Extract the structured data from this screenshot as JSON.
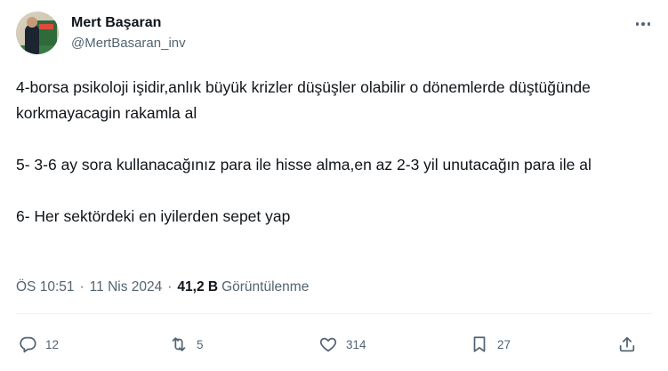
{
  "author": {
    "name": "Mert Başaran",
    "handle": "@MertBasaran_inv"
  },
  "tweet": {
    "paragraphs": [
      "4-borsa psikoloji işidir,anlık büyük krizler düşüşler olabilir o dönemlerde düştüğünde korkmayacagin rakamla al",
      "5- 3-6 ay sora kullanacağınız para ile hisse alma,en az 2-3 yil unutacağın para ile al",
      "6- Her sektördeki en iyilerden sepet yap"
    ]
  },
  "meta": {
    "time": "ÖS 10:51",
    "separator": "·",
    "date": "11 Nis 2024",
    "separator2": "·",
    "views_count": "41,2 B",
    "views_label": "Görüntülenme"
  },
  "actions": {
    "reply_count": "12",
    "retweet_count": "5",
    "like_count": "314",
    "bookmark_count": "27"
  },
  "icons": {
    "reply": "comment-bubble-icon",
    "retweet": "retweet-icon",
    "like": "heart-icon",
    "bookmark": "bookmark-icon",
    "share": "share-upload-icon",
    "more": "more-dots-icon"
  }
}
